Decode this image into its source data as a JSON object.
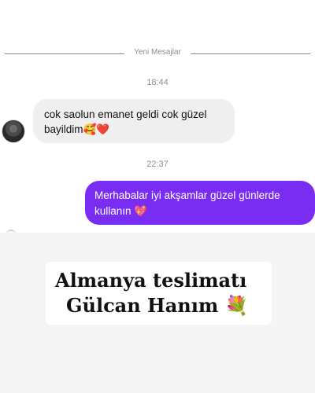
{
  "divider": {
    "label": "Yeni Mesajlar"
  },
  "messages": [
    {
      "time": "18:44",
      "direction": "incoming",
      "line1": "cok saolun emanet geldi cok güzel",
      "line2": "bayildim🥰❤️"
    },
    {
      "time": "22:37",
      "direction": "outgoing",
      "line1": "Merhabalar iyi akşamlar güzel günlerde",
      "line2": "kullanın 💖"
    }
  ],
  "caption": {
    "line1": "Almanya teslimatı",
    "line2": "Gülcan Hanım 💐"
  },
  "colors": {
    "outgoing_bubble": "#7a2df2",
    "incoming_bubble": "#efefef",
    "background_bottom": "#f5f5f5"
  }
}
